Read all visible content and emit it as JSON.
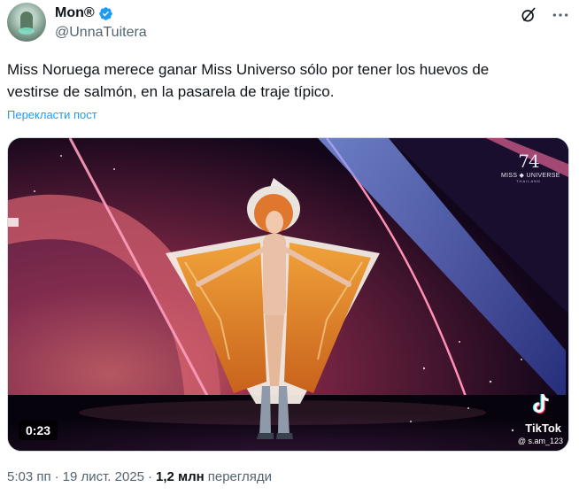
{
  "author": {
    "display_name": "Mon®",
    "handle": "@UnnaTuitera",
    "verified_icon": "verified-badge-icon",
    "avatar_icon": "avatar"
  },
  "header_actions": [
    {
      "name": "grok-icon",
      "label": "Grok"
    },
    {
      "name": "more-options-icon",
      "label": "More"
    }
  ],
  "tweet": {
    "text": "Miss Noruega merece ganar Miss Universo sólo por tener los huevos de\nvestirse de salmón, en la pasarela de traje típico.",
    "translate_label": "Перекласти пост"
  },
  "media": {
    "duration": "0:23",
    "brand_number": "74",
    "brand_text": "MISS ◆ UNIVERSE",
    "brand_sub": "THAILAND",
    "watermark_name": "TikTok",
    "watermark_user": "@ s.am_123",
    "colors": {
      "accent_pink": "#ff7fa8",
      "stage_blue": "#5a7ff0",
      "costume_orange": "#e7892b"
    }
  },
  "footer": {
    "time": "5:03 пп",
    "separator": "·",
    "date": "19 лист. 2025",
    "separator2": "·",
    "views_count": "1,2 млн",
    "views_label": "перегляди"
  }
}
